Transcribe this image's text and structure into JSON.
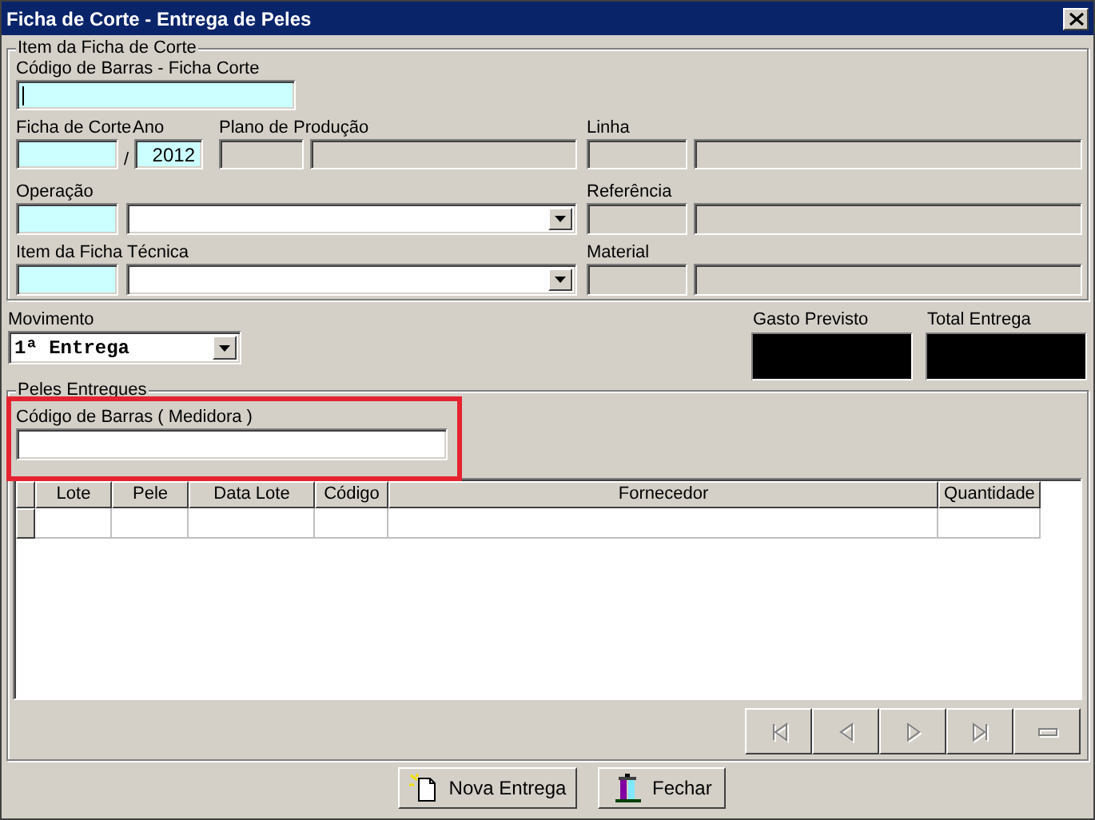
{
  "window": {
    "title": "Ficha de Corte - Entrega de Peles"
  },
  "item_group": {
    "title": "Item da Ficha de Corte",
    "barcode": {
      "label": "Código de Barras - Ficha Corte",
      "focused": true
    },
    "ficha": {
      "label": "Ficha de Corte",
      "ano_label": "Ano",
      "separator": "/",
      "ano_value": "2012"
    },
    "plano": {
      "label": "Plano de Produção"
    },
    "linha": {
      "label": "Linha"
    },
    "operacao": {
      "label": "Operação"
    },
    "referencia": {
      "label": "Referência"
    },
    "item_tecnico": {
      "label": "Item da Ficha Técnica"
    },
    "material": {
      "label": "Material"
    }
  },
  "movimento": {
    "label": "Movimento",
    "value": "1ª Entrega"
  },
  "totals": [
    {
      "label": "Gasto Previsto"
    },
    {
      "label": "Total Entrega"
    }
  ],
  "peles_group": {
    "title": "Peles Entregues",
    "barcode": {
      "label": "Código de Barras ( Medidora )",
      "highlighted": true
    }
  },
  "table": {
    "columns": [
      "Lote",
      "Pele",
      "Data Lote",
      "Código",
      "Fornecedor",
      "Quantidade"
    ]
  },
  "navigator": [
    {
      "kind": "first",
      "disabled": true
    },
    {
      "kind": "prior",
      "disabled": true
    },
    {
      "kind": "next",
      "disabled": true
    },
    {
      "kind": "last",
      "disabled": true
    },
    {
      "kind": "delete",
      "disabled": true
    }
  ],
  "buttons": [
    {
      "kind": "new",
      "label": "Nova Entrega"
    },
    {
      "kind": "close",
      "label": "Fechar"
    }
  ]
}
